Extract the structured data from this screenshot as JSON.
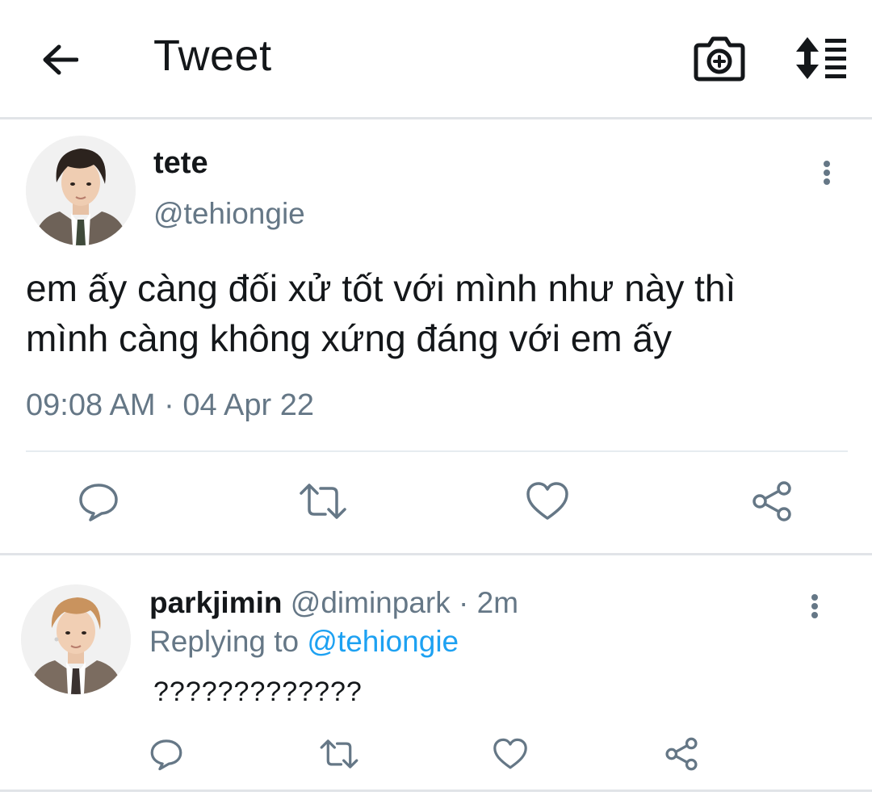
{
  "header": {
    "title": "Tweet",
    "back_icon": "arrow-left-icon",
    "camera_icon": "camera-plus-icon",
    "sort_icon": "sort-list-icon"
  },
  "tweet": {
    "display_name": "tete",
    "handle": "@tehiongie",
    "text_line1": "em ấy càng đối xử tốt với mình như này thì",
    "text_line2": "mình càng không xứng đáng với em ấy",
    "timestamp": "09:08 AM · 04 Apr 22",
    "actions": [
      "reply-icon",
      "retweet-icon",
      "like-icon",
      "share-icon"
    ]
  },
  "reply": {
    "display_name": "parkjimin",
    "handle": "@diminpark",
    "time": "2m",
    "replying_prefix": "Replying to",
    "replying_to": "@tehiongie",
    "text": "?????????????",
    "actions": [
      "reply-icon",
      "retweet-icon",
      "like-icon",
      "share-icon"
    ]
  },
  "colors": {
    "text": "#14171a",
    "secondary": "#657786",
    "accent": "#1da1f2",
    "divider": "#e1e4e8"
  }
}
